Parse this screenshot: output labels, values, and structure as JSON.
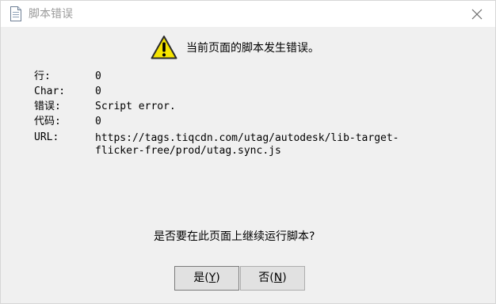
{
  "window": {
    "title": "脚本错误"
  },
  "message": {
    "headline": "当前页面的脚本发生错误。"
  },
  "details": [
    {
      "label": "行:",
      "value": "0"
    },
    {
      "label": "Char:",
      "value": "0"
    },
    {
      "label": "错误:",
      "value": "Script error."
    },
    {
      "label": "代码:",
      "value": "0"
    },
    {
      "label": "URL:",
      "value": "https://tags.tiqcdn.com/utag/autodesk/lib-target-\nflicker-free/prod/utag.sync.js"
    }
  ],
  "question": "是否要在此页面上继续运行脚本?",
  "buttons": {
    "yes": {
      "prefix": "是(",
      "accel": "Y",
      "suffix": ")"
    },
    "no": {
      "prefix": "否(",
      "accel": "N",
      "suffix": ")"
    }
  },
  "icons": {
    "title": "document-icon",
    "close": "close-icon",
    "warning": "warning-icon"
  },
  "colors": {
    "window_bg": "#f0f0f0",
    "titlebar_bg": "#ffffff",
    "warning_fill": "#f5e400",
    "button_bg": "#e1e1e1"
  }
}
